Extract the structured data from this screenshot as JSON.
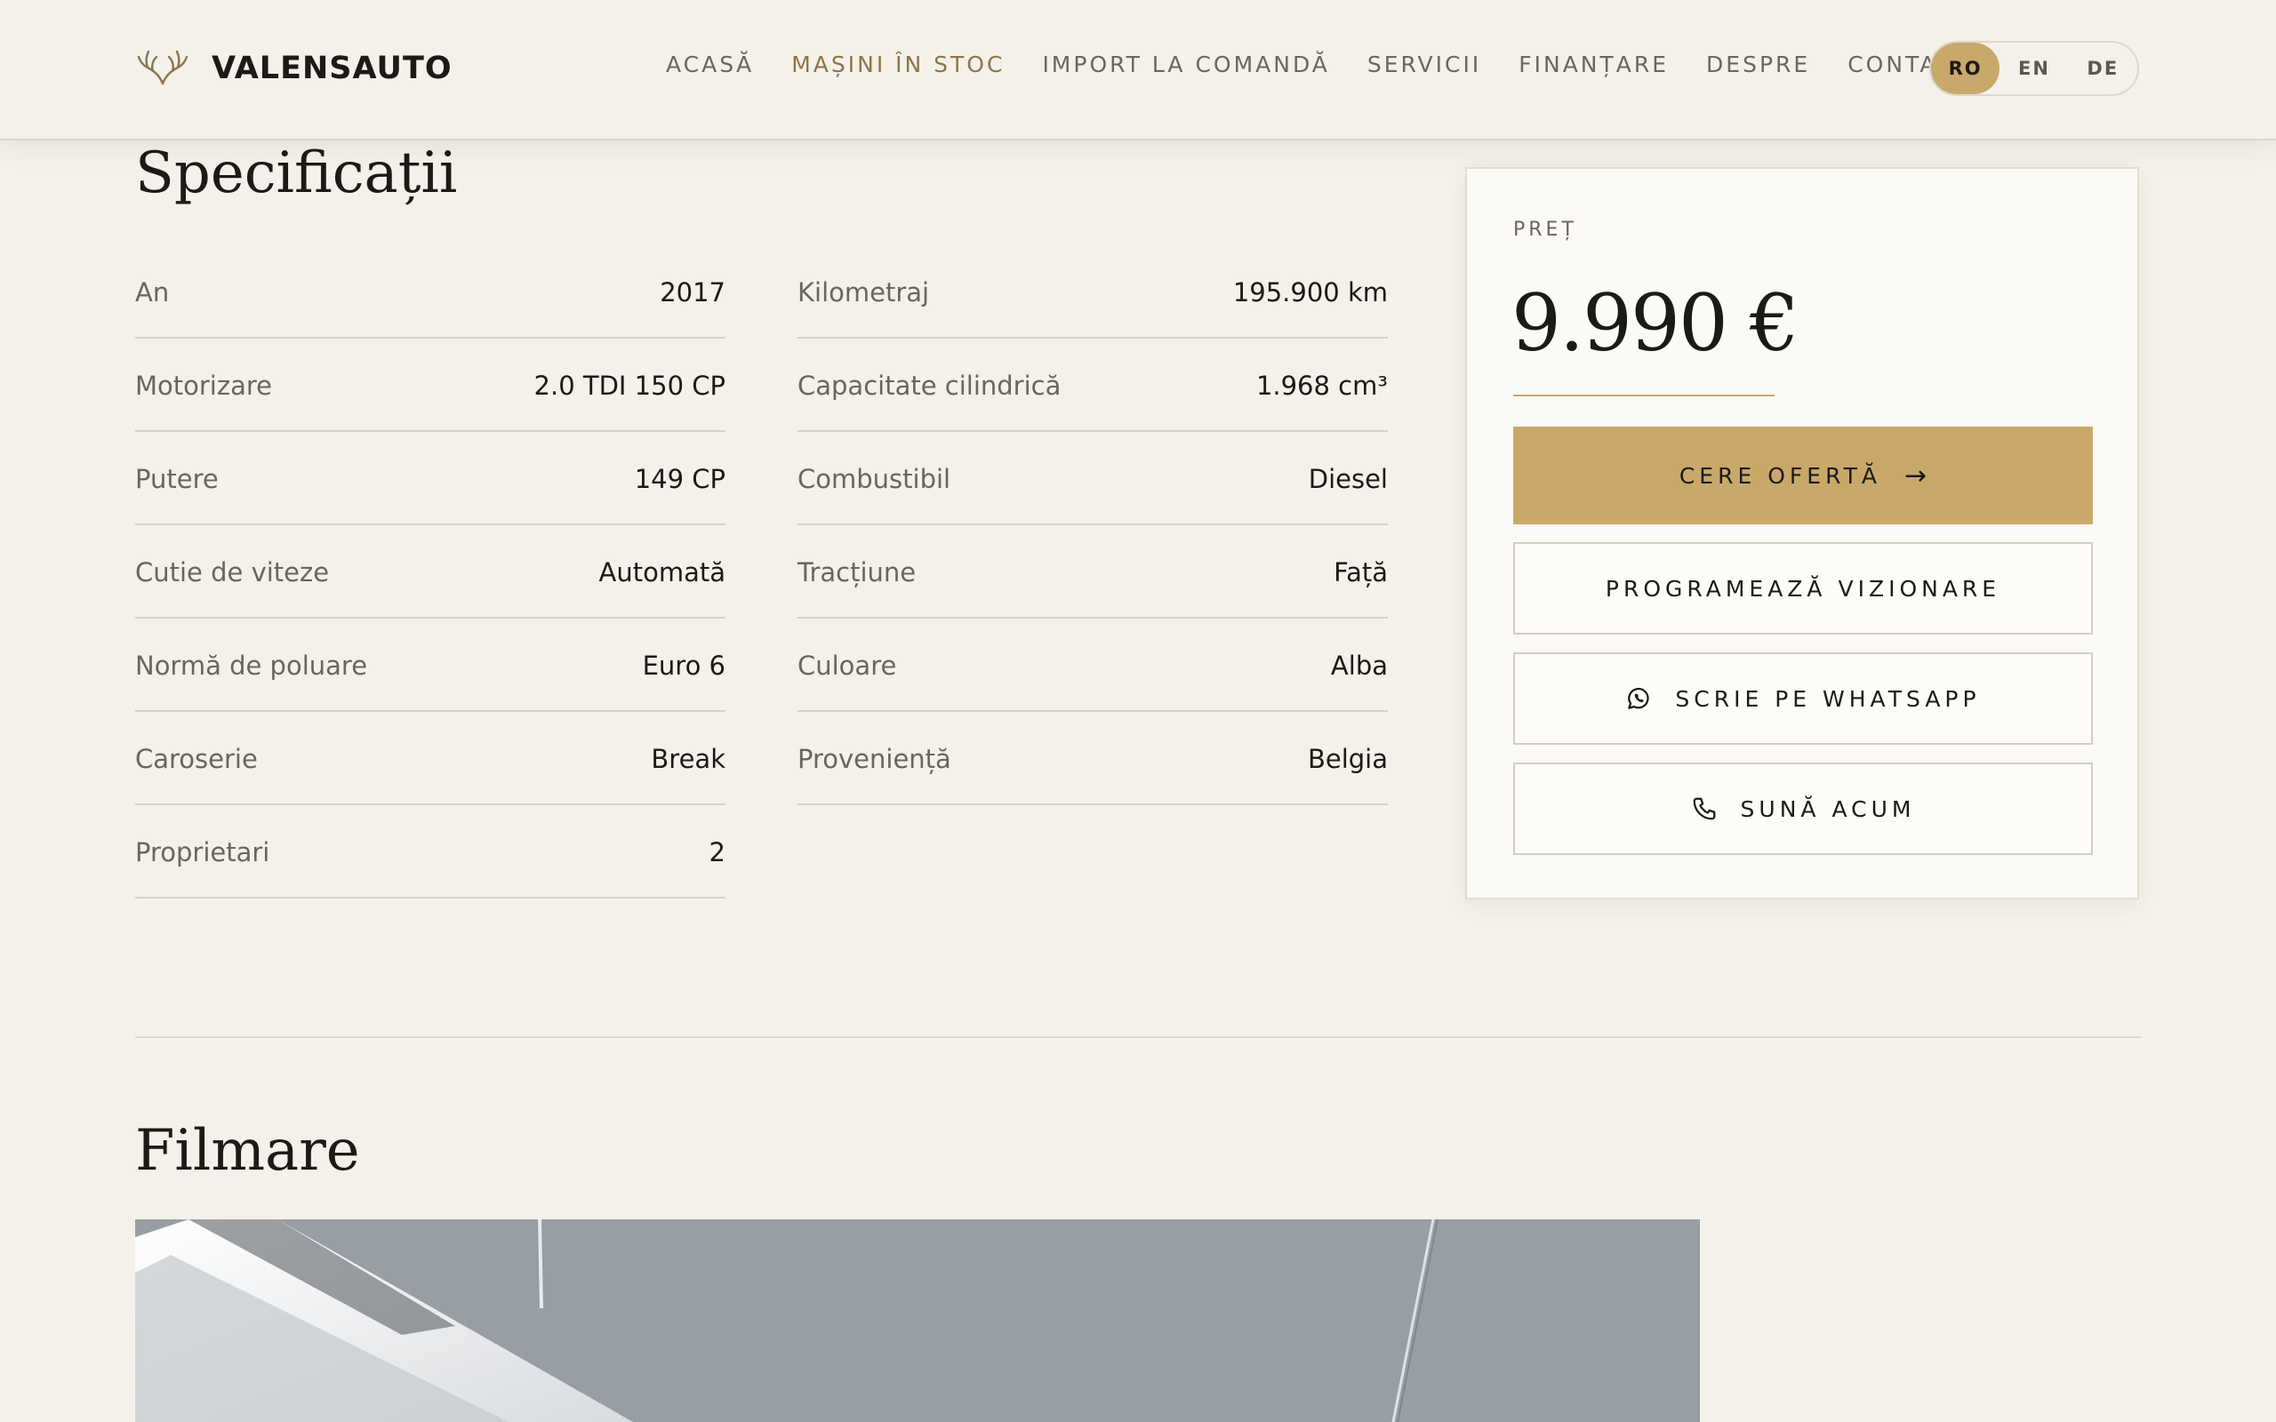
{
  "brand": {
    "name": "VALENSAUTO",
    "logo_icon": "antlers-logo"
  },
  "nav": {
    "items": [
      {
        "label": "ACASĂ",
        "active": false
      },
      {
        "label": "MAȘINI ÎN STOC",
        "active": true
      },
      {
        "label": "IMPORT LA COMANDĂ",
        "active": false
      },
      {
        "label": "SERVICII",
        "active": false
      },
      {
        "label": "FINANȚARE",
        "active": false
      },
      {
        "label": "DESPRE",
        "active": false
      },
      {
        "label": "CONTACT",
        "active": false
      }
    ]
  },
  "languages": {
    "options": [
      "RO",
      "EN",
      "DE"
    ],
    "selected": "RO"
  },
  "specs": {
    "title": "Specificații",
    "left": [
      {
        "label": "An",
        "value": "2017"
      },
      {
        "label": "Motorizare",
        "value": "2.0 TDI 150 CP"
      },
      {
        "label": "Putere",
        "value": "149 CP"
      },
      {
        "label": "Cutie de viteze",
        "value": "Automată"
      },
      {
        "label": "Normă de poluare",
        "value": "Euro 6"
      },
      {
        "label": "Caroserie",
        "value": "Break"
      },
      {
        "label": "Proprietari",
        "value": "2"
      }
    ],
    "right": [
      {
        "label": "Kilometraj",
        "value": "195.900 km"
      },
      {
        "label": "Capacitate cilindrică",
        "value": "1.968 cm³"
      },
      {
        "label": "Combustibil",
        "value": "Diesel"
      },
      {
        "label": "Tracțiune",
        "value": "Față"
      },
      {
        "label": "Culoare",
        "value": "Alba"
      },
      {
        "label": "Proveniență",
        "value": "Belgia"
      }
    ]
  },
  "price": {
    "label": "PREȚ",
    "value": "9.990 €",
    "request_offer": "CERE OFERTĂ",
    "request_offer_arrow": "→",
    "schedule_viewing": "PROGRAMEAZĂ VIZIONARE",
    "whatsapp": "SCRIE PE WHATSAPP",
    "call": "SUNĂ ACUM"
  },
  "video": {
    "title": "Filmare"
  },
  "colors": {
    "accent": "#c9a96a",
    "background": "#f4f1ea",
    "card": "#fbfaf6",
    "text": "#1b1a17"
  }
}
